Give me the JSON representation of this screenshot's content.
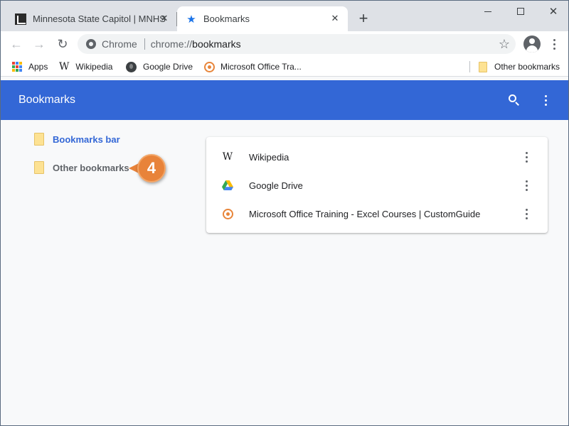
{
  "tabs": [
    {
      "title": "Minnesota State Capitol | MNHS",
      "icon": "mnhs-favicon",
      "active": false
    },
    {
      "title": "Bookmarks",
      "icon": "star-icon",
      "active": true
    }
  ],
  "toolbar": {
    "site_chip": "Chrome",
    "url_scheme": "chrome://",
    "url_path": "bookmarks"
  },
  "bookmarks_bar": {
    "items": [
      {
        "label": "Apps",
        "icon": "apps-grid-icon"
      },
      {
        "label": "Wikipedia",
        "icon": "wikipedia-icon"
      },
      {
        "label": "Google Drive",
        "icon": "globe-icon"
      },
      {
        "label": "Microsoft Office Tra...",
        "icon": "customguide-icon"
      }
    ],
    "other_label": "Other bookmarks"
  },
  "manager": {
    "title": "Bookmarks",
    "sidebar": [
      {
        "label": "Bookmarks bar",
        "selected": true
      },
      {
        "label": "Other bookmarks",
        "selected": false
      }
    ],
    "list": [
      {
        "title": "Wikipedia",
        "icon": "wikipedia-icon"
      },
      {
        "title": "Google Drive",
        "icon": "google-drive-icon"
      },
      {
        "title": "Microsoft Office Training - Excel Courses | CustomGuide",
        "icon": "customguide-icon"
      }
    ]
  },
  "callout": {
    "number": "4"
  },
  "colors": {
    "header_blue": "#3367d6",
    "accent_orange": "#e8833a",
    "folder_yellow": "#fde293",
    "tab_strip": "#dee1e6"
  }
}
